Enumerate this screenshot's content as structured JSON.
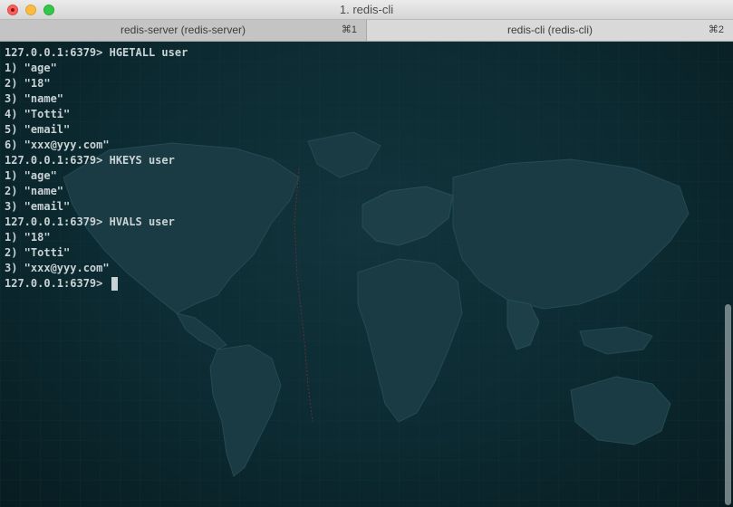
{
  "window": {
    "title": "1. redis-cli",
    "buttons": {
      "close": "close-icon",
      "minimize": "minimize-icon",
      "zoom": "zoom-icon"
    }
  },
  "tabs": [
    {
      "label": "redis-server (redis-server)",
      "shortcut": "⌘1",
      "active": true
    },
    {
      "label": "redis-cli (redis-cli)",
      "shortcut": "⌘2",
      "active": false
    }
  ],
  "terminal": {
    "background_theme": "world-map",
    "colors": {
      "background": "#0c2a31",
      "text": "#c9d2d4"
    },
    "lines": [
      "127.0.0.1:6379> HGETALL user",
      "1) \"age\"",
      "2) \"18\"",
      "3) \"name\"",
      "4) \"Totti\"",
      "5) \"email\"",
      "6) \"xxx@yyy.com\"",
      "127.0.0.1:6379> HKEYS user",
      "1) \"age\"",
      "2) \"name\"",
      "3) \"email\"",
      "127.0.0.1:6379> HVALS user",
      "1) \"18\"",
      "2) \"Totti\"",
      "3) \"xxx@yyy.com\""
    ],
    "prompt": "127.0.0.1:6379> "
  }
}
